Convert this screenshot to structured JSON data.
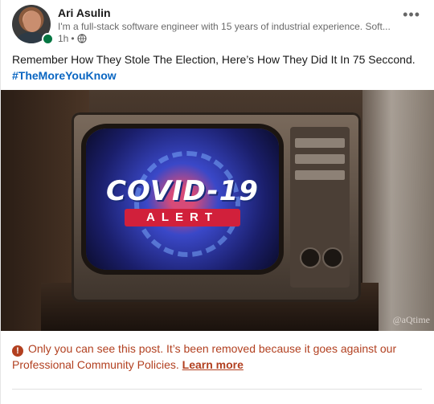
{
  "author": {
    "name": "Ari Asulin",
    "headline": "I'm a full-stack software engineer with 15 years of industrial experience. Soft...",
    "time": "1h",
    "separator": "•",
    "presence_color": "#057642",
    "visibility_icon": "globe-icon"
  },
  "menu": {
    "icon": "more-dots-icon",
    "label": "•••"
  },
  "post": {
    "text": "Remember How They Stole The Election, Here’s How They Did It In 75 Seccond.",
    "hashtag": "#TheMoreYouKnow"
  },
  "media": {
    "headline": "COVID-19",
    "badge": "ALERT",
    "watermark": "@aQtime"
  },
  "notice": {
    "icon": "warning-icon",
    "icon_glyph": "!",
    "text": "Only you can see this post. It’s been removed because it goes against our Professional Community Policies.",
    "link_label": "Learn more",
    "color": "#b24020"
  },
  "colors": {
    "hashtag": "#0a66c2"
  }
}
